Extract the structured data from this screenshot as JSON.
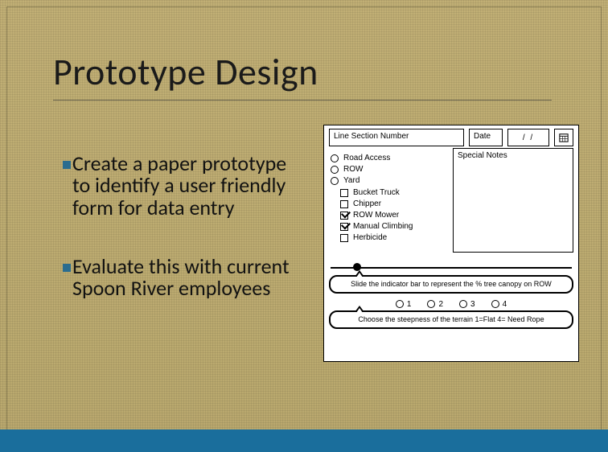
{
  "title": "Prototype Design",
  "bullets": [
    "Create a paper prototype to identify a user friendly form for data entry",
    "Evaluate this with current Spoon River employees"
  ],
  "form": {
    "line_section_label": "Line Section Number",
    "date_label": "Date",
    "date_value": "/    /",
    "radios": [
      "Road Access",
      "ROW",
      "Yard"
    ],
    "notes_label": "Special Notes",
    "checks": [
      {
        "label": "Bucket Truck",
        "checked": false
      },
      {
        "label": "Chipper",
        "checked": false
      },
      {
        "label": "ROW Mower",
        "checked": true
      },
      {
        "label": "Manual Climbing",
        "checked": true
      },
      {
        "label": "Herbicide",
        "checked": false
      }
    ],
    "slider_hint": "Slide the indicator bar to represent the % tree canopy on ROW",
    "scale": [
      "1",
      "2",
      "3",
      "4"
    ],
    "steep_hint": "Choose the steepness of the terrain 1=Flat 4= Need Rope"
  }
}
